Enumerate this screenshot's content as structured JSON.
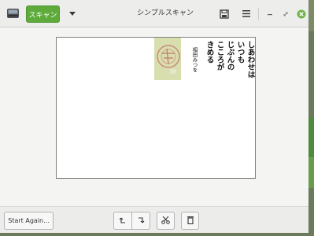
{
  "window": {
    "title": "シンプルスキャン"
  },
  "toolbar": {
    "scan_label": "スキャン"
  },
  "document": {
    "poem_lines": [
      "しあわせは",
      "いつも",
      "じぶんの",
      "こころが",
      "きめる"
    ],
    "signature": "相田みつを"
  },
  "footer": {
    "start_again_label": "Start Again..."
  },
  "icons": {
    "app": "scanner-icon",
    "dropdown": "triangle-down-icon",
    "save": "save-icon",
    "menu": "hamburger-menu-icon",
    "minimize": "minimize-icon",
    "restore": "restore-icon",
    "close": "close-icon",
    "rotate_left": "rotate-left-icon",
    "rotate_right": "rotate-right-icon",
    "crop": "scissors-icon",
    "delete": "trash-icon"
  },
  "colors": {
    "accent": "#5eab3c",
    "close": "#72b44a",
    "background": "#6b7a5a"
  }
}
